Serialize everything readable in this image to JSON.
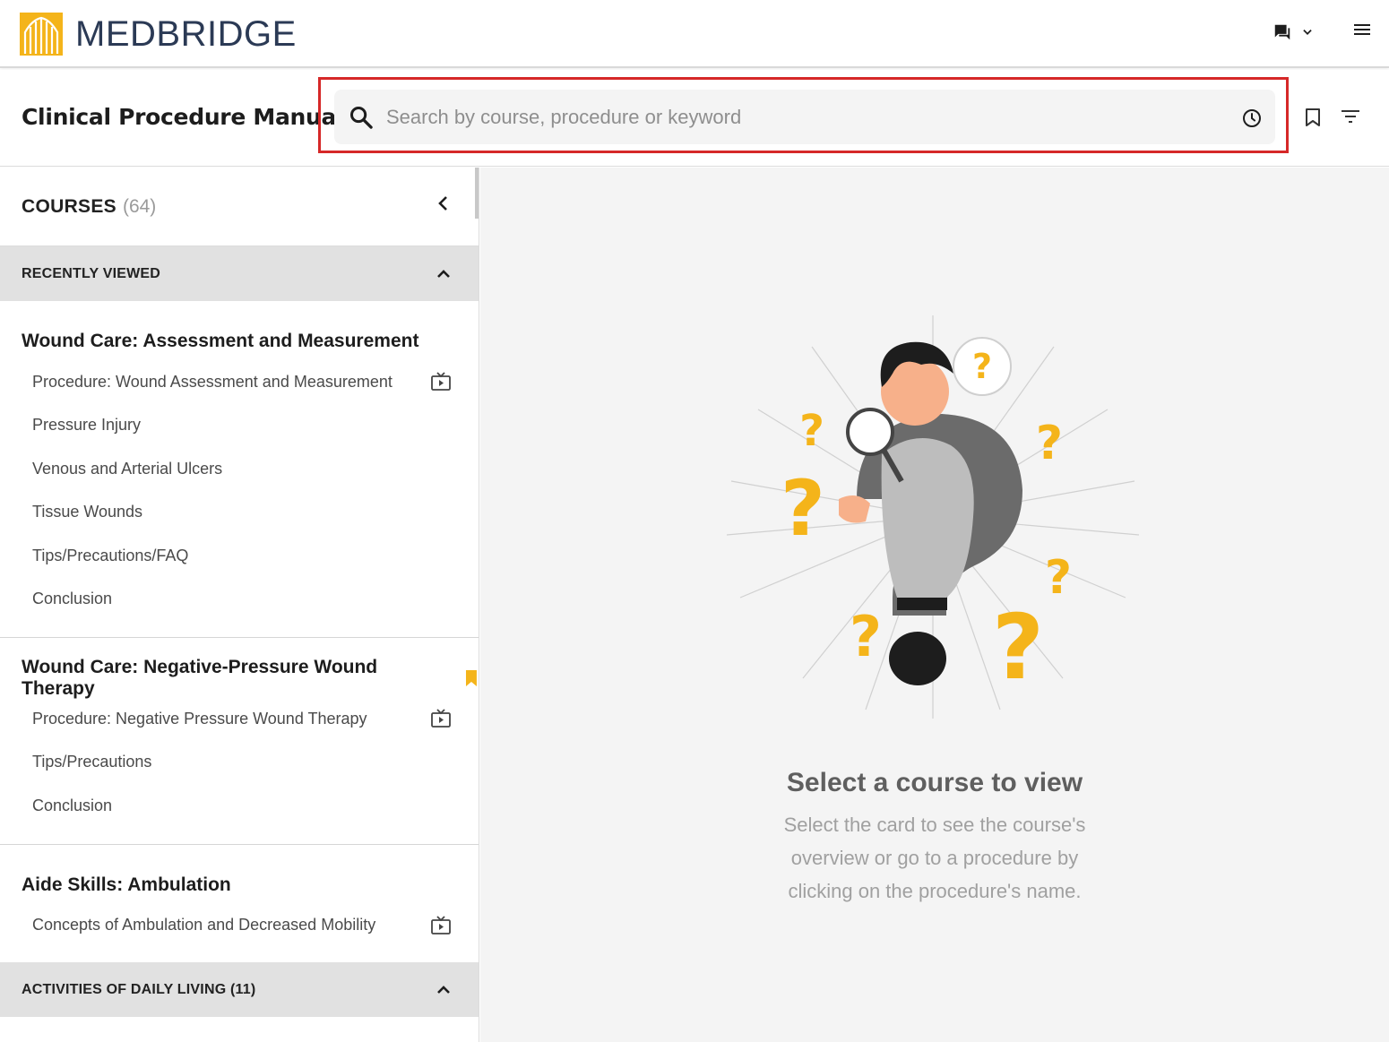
{
  "brand": {
    "name": "MEDBRIDGE",
    "color": "#f4b41a",
    "text_color": "#2b3a55"
  },
  "topbar": {
    "chat_icon": "chat-icon",
    "menu_icon": "hamburger-menu-icon"
  },
  "header": {
    "title": "Clinical Procedure Manual",
    "search": {
      "placeholder": "Search by course, procedure or keyword",
      "value": ""
    }
  },
  "sidebar": {
    "courses_label": "COURSES",
    "courses_count": "(64)",
    "recently_viewed_label": "RECENTLY VIEWED",
    "courses": [
      {
        "title": "Wound Care: Assessment and Measurement",
        "bookmarked": false,
        "items": [
          {
            "label": "Procedure: Wound Assessment and Measurement",
            "video": true
          },
          {
            "label": "Pressure Injury",
            "video": false
          },
          {
            "label": "Venous and Arterial Ulcers",
            "video": false
          },
          {
            "label": "Tissue Wounds",
            "video": false
          },
          {
            "label": "Tips/Precautions/FAQ",
            "video": false
          },
          {
            "label": "Conclusion",
            "video": false
          }
        ]
      },
      {
        "title": "Wound Care: Negative-Pressure Wound Therapy",
        "bookmarked": true,
        "items": [
          {
            "label": "Procedure: Negative Pressure Wound Therapy",
            "video": true
          },
          {
            "label": "Tips/Precautions",
            "video": false
          },
          {
            "label": "Conclusion",
            "video": false
          }
        ]
      },
      {
        "title": "Aide Skills: Ambulation",
        "bookmarked": false,
        "items": [
          {
            "label": "Concepts of Ambulation and Decreased Mobility",
            "video": true
          }
        ]
      }
    ],
    "second_section_label": "ACTIVITIES OF DAILY LIVING (11)"
  },
  "main": {
    "empty_title": "Select a course to view",
    "empty_description": "Select the card to see the course's overview or go to a procedure by clicking on the procedure's name.",
    "illustration": "person-with-magnifier-question-marks"
  },
  "colors": {
    "highlight": "#d62828",
    "accent_yellow": "#f4b41a"
  }
}
